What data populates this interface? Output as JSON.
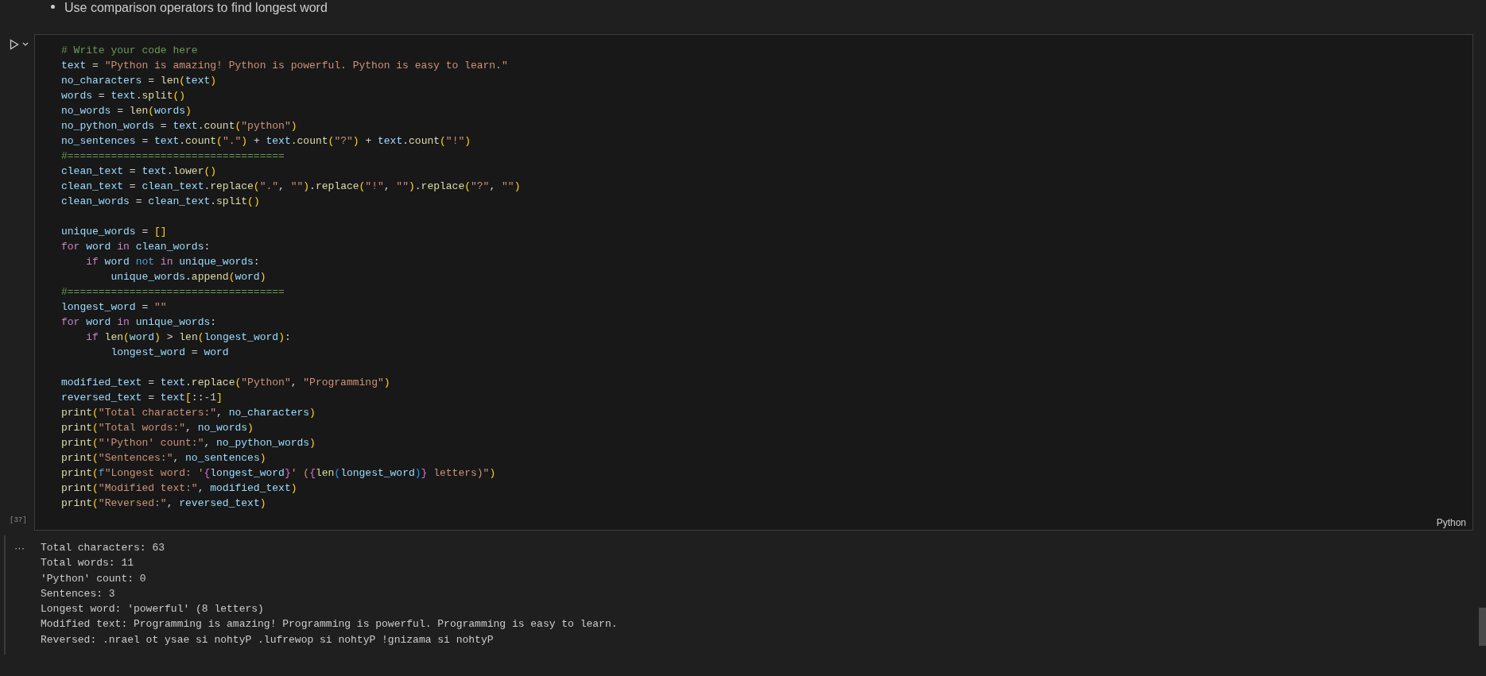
{
  "markdown_bullet": "Use comparison operators to find longest word",
  "cell": {
    "execution_count": "[37]",
    "language": "Python",
    "output_marker": "···",
    "lines": [
      {
        "kind": "code",
        "tokens": [
          {
            "text": "# Write your code here",
            "kind": "comment"
          }
        ]
      },
      {
        "kind": "code",
        "tokens": [
          {
            "text": "text",
            "kind": "var"
          },
          {
            "text": " = ",
            "kind": "plain"
          },
          {
            "text": "\"Python is amazing! Python is powerful. Python is easy to learn.\"",
            "kind": "string"
          }
        ]
      },
      {
        "kind": "code",
        "tokens": [
          {
            "text": "no_characters",
            "kind": "var"
          },
          {
            "text": " = ",
            "kind": "plain"
          },
          {
            "text": "len",
            "kind": "function"
          },
          {
            "text": "(",
            "kind": "bracket1"
          },
          {
            "text": "text",
            "kind": "var"
          },
          {
            "text": ")",
            "kind": "bracket1"
          }
        ]
      },
      {
        "kind": "code",
        "tokens": [
          {
            "text": "words",
            "kind": "var"
          },
          {
            "text": " = ",
            "kind": "plain"
          },
          {
            "text": "text",
            "kind": "var"
          },
          {
            "text": ".",
            "kind": "plain"
          },
          {
            "text": "split",
            "kind": "function"
          },
          {
            "text": "()",
            "kind": "bracket1"
          }
        ]
      },
      {
        "kind": "code",
        "tokens": [
          {
            "text": "no_words",
            "kind": "var"
          },
          {
            "text": " = ",
            "kind": "plain"
          },
          {
            "text": "len",
            "kind": "function"
          },
          {
            "text": "(",
            "kind": "bracket1"
          },
          {
            "text": "words",
            "kind": "var"
          },
          {
            "text": ")",
            "kind": "bracket1"
          }
        ]
      },
      {
        "kind": "code",
        "tokens": [
          {
            "text": "no_python_words",
            "kind": "var"
          },
          {
            "text": " = ",
            "kind": "plain"
          },
          {
            "text": "text",
            "kind": "var"
          },
          {
            "text": ".",
            "kind": "plain"
          },
          {
            "text": "count",
            "kind": "function"
          },
          {
            "text": "(",
            "kind": "bracket1"
          },
          {
            "text": "\"python\"",
            "kind": "string"
          },
          {
            "text": ")",
            "kind": "bracket1"
          }
        ]
      },
      {
        "kind": "code",
        "tokens": [
          {
            "text": "no_sentences",
            "kind": "var"
          },
          {
            "text": " = ",
            "kind": "plain"
          },
          {
            "text": "text",
            "kind": "var"
          },
          {
            "text": ".",
            "kind": "plain"
          },
          {
            "text": "count",
            "kind": "function"
          },
          {
            "text": "(",
            "kind": "bracket1"
          },
          {
            "text": "\".\"",
            "kind": "string"
          },
          {
            "text": ")",
            "kind": "bracket1"
          },
          {
            "text": " + ",
            "kind": "plain"
          },
          {
            "text": "text",
            "kind": "var"
          },
          {
            "text": ".",
            "kind": "plain"
          },
          {
            "text": "count",
            "kind": "function"
          },
          {
            "text": "(",
            "kind": "bracket1"
          },
          {
            "text": "\"?\"",
            "kind": "string"
          },
          {
            "text": ")",
            "kind": "bracket1"
          },
          {
            "text": " + ",
            "kind": "plain"
          },
          {
            "text": "text",
            "kind": "var"
          },
          {
            "text": ".",
            "kind": "plain"
          },
          {
            "text": "count",
            "kind": "function"
          },
          {
            "text": "(",
            "kind": "bracket1"
          },
          {
            "text": "\"!\"",
            "kind": "string"
          },
          {
            "text": ")",
            "kind": "bracket1"
          }
        ]
      },
      {
        "kind": "code",
        "tokens": [
          {
            "text": "#===================================",
            "kind": "comment"
          }
        ]
      },
      {
        "kind": "code",
        "tokens": [
          {
            "text": "clean_text",
            "kind": "var"
          },
          {
            "text": " = ",
            "kind": "plain"
          },
          {
            "text": "text",
            "kind": "var"
          },
          {
            "text": ".",
            "kind": "plain"
          },
          {
            "text": "lower",
            "kind": "function"
          },
          {
            "text": "()",
            "kind": "bracket1"
          }
        ]
      },
      {
        "kind": "code",
        "tokens": [
          {
            "text": "clean_text",
            "kind": "var"
          },
          {
            "text": " = ",
            "kind": "plain"
          },
          {
            "text": "clean_text",
            "kind": "var"
          },
          {
            "text": ".",
            "kind": "plain"
          },
          {
            "text": "replace",
            "kind": "function"
          },
          {
            "text": "(",
            "kind": "bracket1"
          },
          {
            "text": "\".\"",
            "kind": "string"
          },
          {
            "text": ", ",
            "kind": "plain"
          },
          {
            "text": "\"\"",
            "kind": "string"
          },
          {
            "text": ")",
            "kind": "bracket1"
          },
          {
            "text": ".",
            "kind": "plain"
          },
          {
            "text": "replace",
            "kind": "function"
          },
          {
            "text": "(",
            "kind": "bracket1"
          },
          {
            "text": "\"!\"",
            "kind": "string"
          },
          {
            "text": ", ",
            "kind": "plain"
          },
          {
            "text": "\"\"",
            "kind": "string"
          },
          {
            "text": ")",
            "kind": "bracket1"
          },
          {
            "text": ".",
            "kind": "plain"
          },
          {
            "text": "replace",
            "kind": "function"
          },
          {
            "text": "(",
            "kind": "bracket1"
          },
          {
            "text": "\"?\"",
            "kind": "string"
          },
          {
            "text": ", ",
            "kind": "plain"
          },
          {
            "text": "\"\"",
            "kind": "string"
          },
          {
            "text": ")",
            "kind": "bracket1"
          }
        ]
      },
      {
        "kind": "code",
        "tokens": [
          {
            "text": "clean_words",
            "kind": "var"
          },
          {
            "text": " = ",
            "kind": "plain"
          },
          {
            "text": "clean_text",
            "kind": "var"
          },
          {
            "text": ".",
            "kind": "plain"
          },
          {
            "text": "split",
            "kind": "function"
          },
          {
            "text": "()",
            "kind": "bracket1"
          }
        ]
      },
      {
        "kind": "blank"
      },
      {
        "kind": "code",
        "tokens": [
          {
            "text": "unique_words",
            "kind": "var"
          },
          {
            "text": " = ",
            "kind": "plain"
          },
          {
            "text": "[]",
            "kind": "bracket1"
          }
        ]
      },
      {
        "kind": "code",
        "tokens": [
          {
            "text": "for",
            "kind": "control"
          },
          {
            "text": " word ",
            "kind": "var"
          },
          {
            "text": "in",
            "kind": "control"
          },
          {
            "text": " clean_words",
            "kind": "var"
          },
          {
            "text": ":",
            "kind": "plain"
          }
        ]
      },
      {
        "kind": "code",
        "tokens": [
          {
            "text": "    if",
            "kind": "control"
          },
          {
            "text": " word ",
            "kind": "var"
          },
          {
            "text": "not",
            "kind": "keyword"
          },
          {
            "text": " in",
            "kind": "control"
          },
          {
            "text": " unique_words",
            "kind": "var"
          },
          {
            "text": ":",
            "kind": "plain"
          }
        ]
      },
      {
        "kind": "code",
        "tokens": [
          {
            "text": "        unique_words",
            "kind": "var"
          },
          {
            "text": ".",
            "kind": "plain"
          },
          {
            "text": "append",
            "kind": "function"
          },
          {
            "text": "(",
            "kind": "bracket1"
          },
          {
            "text": "word",
            "kind": "var"
          },
          {
            "text": ")",
            "kind": "bracket1"
          }
        ]
      },
      {
        "kind": "code",
        "tokens": [
          {
            "text": "#===================================",
            "kind": "comment"
          }
        ]
      },
      {
        "kind": "code",
        "tokens": [
          {
            "text": "longest_word",
            "kind": "var"
          },
          {
            "text": " = ",
            "kind": "plain"
          },
          {
            "text": "\"\"",
            "kind": "string"
          }
        ]
      },
      {
        "kind": "code",
        "tokens": [
          {
            "text": "for",
            "kind": "control"
          },
          {
            "text": " word ",
            "kind": "var"
          },
          {
            "text": "in",
            "kind": "control"
          },
          {
            "text": " unique_words",
            "kind": "var"
          },
          {
            "text": ":",
            "kind": "plain"
          }
        ]
      },
      {
        "kind": "code",
        "tokens": [
          {
            "text": "    if",
            "kind": "control"
          },
          {
            "text": " len",
            "kind": "function"
          },
          {
            "text": "(",
            "kind": "bracket1"
          },
          {
            "text": "word",
            "kind": "var"
          },
          {
            "text": ")",
            "kind": "bracket1"
          },
          {
            "text": " > ",
            "kind": "plain"
          },
          {
            "text": "len",
            "kind": "function"
          },
          {
            "text": "(",
            "kind": "bracket1"
          },
          {
            "text": "longest_word",
            "kind": "var"
          },
          {
            "text": ")",
            "kind": "bracket1"
          },
          {
            "text": ":",
            "kind": "plain"
          }
        ]
      },
      {
        "kind": "code",
        "tokens": [
          {
            "text": "        longest_word",
            "kind": "var"
          },
          {
            "text": " = ",
            "kind": "plain"
          },
          {
            "text": "word",
            "kind": "var"
          }
        ]
      },
      {
        "kind": "blank"
      },
      {
        "kind": "code",
        "tokens": [
          {
            "text": "modified_text",
            "kind": "var"
          },
          {
            "text": " = ",
            "kind": "plain"
          },
          {
            "text": "text",
            "kind": "var"
          },
          {
            "text": ".",
            "kind": "plain"
          },
          {
            "text": "replace",
            "kind": "function"
          },
          {
            "text": "(",
            "kind": "bracket1"
          },
          {
            "text": "\"Python\"",
            "kind": "string"
          },
          {
            "text": ", ",
            "kind": "plain"
          },
          {
            "text": "\"Programming\"",
            "kind": "string"
          },
          {
            "text": ")",
            "kind": "bracket1"
          }
        ]
      },
      {
        "kind": "code",
        "tokens": [
          {
            "text": "reversed_text",
            "kind": "var"
          },
          {
            "text": " = ",
            "kind": "plain"
          },
          {
            "text": "text",
            "kind": "var"
          },
          {
            "text": "[",
            "kind": "bracket1"
          },
          {
            "text": "::",
            "kind": "plain"
          },
          {
            "text": "-1",
            "kind": "number"
          },
          {
            "text": "]",
            "kind": "bracket1"
          }
        ]
      },
      {
        "kind": "code",
        "tokens": [
          {
            "text": "print",
            "kind": "function"
          },
          {
            "text": "(",
            "kind": "bracket1"
          },
          {
            "text": "\"Total characters:\"",
            "kind": "string"
          },
          {
            "text": ", ",
            "kind": "plain"
          },
          {
            "text": "no_characters",
            "kind": "var"
          },
          {
            "text": ")",
            "kind": "bracket1"
          }
        ]
      },
      {
        "kind": "code",
        "tokens": [
          {
            "text": "print",
            "kind": "function"
          },
          {
            "text": "(",
            "kind": "bracket1"
          },
          {
            "text": "\"Total words:\"",
            "kind": "string"
          },
          {
            "text": ", ",
            "kind": "plain"
          },
          {
            "text": "no_words",
            "kind": "var"
          },
          {
            "text": ")",
            "kind": "bracket1"
          }
        ]
      },
      {
        "kind": "code",
        "tokens": [
          {
            "text": "print",
            "kind": "function"
          },
          {
            "text": "(",
            "kind": "bracket1"
          },
          {
            "text": "\"'Python' count:\"",
            "kind": "string"
          },
          {
            "text": ", ",
            "kind": "plain"
          },
          {
            "text": "no_python_words",
            "kind": "var"
          },
          {
            "text": ")",
            "kind": "bracket1"
          }
        ]
      },
      {
        "kind": "code",
        "tokens": [
          {
            "text": "print",
            "kind": "function"
          },
          {
            "text": "(",
            "kind": "bracket1"
          },
          {
            "text": "\"Sentences:\"",
            "kind": "string"
          },
          {
            "text": ", ",
            "kind": "plain"
          },
          {
            "text": "no_sentences",
            "kind": "var"
          },
          {
            "text": ")",
            "kind": "bracket1"
          }
        ]
      },
      {
        "kind": "code",
        "tokens": [
          {
            "text": "print",
            "kind": "function"
          },
          {
            "text": "(",
            "kind": "bracket1"
          },
          {
            "text": "f",
            "kind": "keyword"
          },
          {
            "text": "\"Longest word: '",
            "kind": "string"
          },
          {
            "text": "{",
            "kind": "bracket2"
          },
          {
            "text": "longest_word",
            "kind": "var"
          },
          {
            "text": "}",
            "kind": "bracket2"
          },
          {
            "text": "' (",
            "kind": "string"
          },
          {
            "text": "{",
            "kind": "bracket2"
          },
          {
            "text": "len",
            "kind": "function"
          },
          {
            "text": "(",
            "kind": "bracket3"
          },
          {
            "text": "longest_word",
            "kind": "var"
          },
          {
            "text": ")",
            "kind": "bracket3"
          },
          {
            "text": "}",
            "kind": "bracket2"
          },
          {
            "text": " letters)\"",
            "kind": "string"
          },
          {
            "text": ")",
            "kind": "bracket1"
          }
        ]
      },
      {
        "kind": "code",
        "tokens": [
          {
            "text": "print",
            "kind": "function"
          },
          {
            "text": "(",
            "kind": "bracket1"
          },
          {
            "text": "\"Modified text:\"",
            "kind": "string"
          },
          {
            "text": ", ",
            "kind": "plain"
          },
          {
            "text": "modified_text",
            "kind": "var"
          },
          {
            "text": ")",
            "kind": "bracket1"
          }
        ]
      },
      {
        "kind": "code",
        "tokens": [
          {
            "text": "print",
            "kind": "function"
          },
          {
            "text": "(",
            "kind": "bracket1"
          },
          {
            "text": "\"Reversed:\"",
            "kind": "string"
          },
          {
            "text": ", ",
            "kind": "plain"
          },
          {
            "text": "reversed_text",
            "kind": "var"
          },
          {
            "text": ")",
            "kind": "bracket1"
          }
        ]
      }
    ],
    "output": [
      "Total characters: 63",
      "Total words: 11",
      "'Python' count: 0",
      "Sentences: 3",
      "Longest word: 'powerful' (8 letters)",
      "Modified text: Programming is amazing! Programming is powerful. Programming is easy to learn.",
      "Reversed: .nrael ot ysae si nohtyP .lufrewop si nohtyP !gnizama si nohtyP"
    ]
  }
}
